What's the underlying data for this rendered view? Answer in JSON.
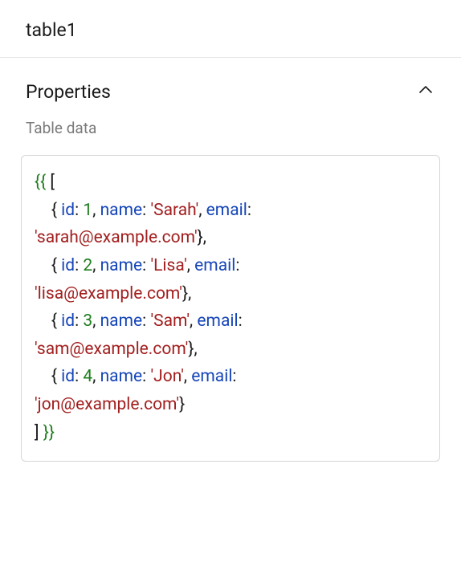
{
  "header": {
    "component_name": "table1"
  },
  "panel": {
    "section_title": "Properties",
    "field_label": "Table data"
  },
  "code": {
    "open_braces": "{{ ",
    "close_braces": " }}",
    "open_bracket": "[",
    "close_bracket": "]",
    "row_open": "    { ",
    "row_close": "}",
    "row_close_comma": "},",
    "kv_sep": ": ",
    "item_sep": ", ",
    "key_id": "id",
    "key_name": "name",
    "key_email": "email",
    "rows": [
      {
        "id": "1",
        "name": "'Sarah'",
        "email": "'sarah@example.com'"
      },
      {
        "id": "2",
        "name": "'Lisa'",
        "email": "'lisa@example.com'"
      },
      {
        "id": "3",
        "name": "'Sam'",
        "email": "'sam@example.com'"
      },
      {
        "id": "4",
        "name": "'Jon'",
        "email": "'jon@example.com'"
      }
    ]
  }
}
